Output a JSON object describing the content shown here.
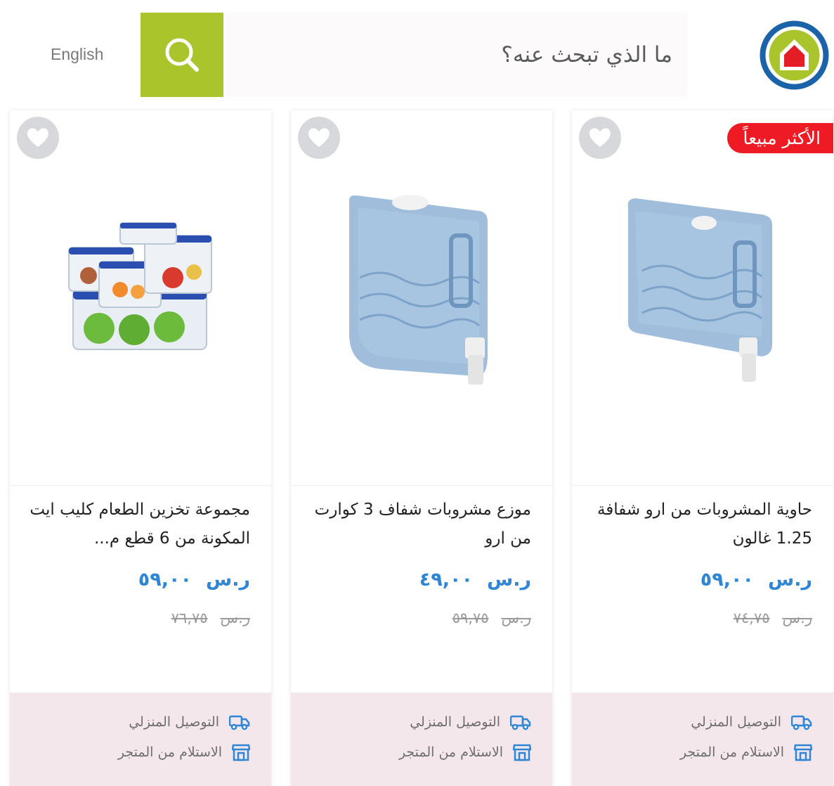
{
  "header": {
    "language_label": "English",
    "search_placeholder": "ما الذي تبحث عنه؟"
  },
  "colors": {
    "accent_green": "#a9c52b",
    "price_blue": "#2f86d6",
    "badge_red": "#ee1b24",
    "logo_blue": "#1a63a8",
    "logo_green": "#a9c52b"
  },
  "products": [
    {
      "badge": "الأكثر مبيعاً",
      "title": "حاوية المشروبات من ارو شفافة 1.25 غالون",
      "price": "٥٩,٠٠",
      "currency": "ر.س",
      "old_price": "٧٤,٧٥",
      "delivery_label": "التوصيل المنزلي",
      "pickup_label": "الاستلام من المتجر"
    },
    {
      "badge": "",
      "title": "موزع مشروبات شفاف 3 كوارت من ارو",
      "price": "٤٩,٠٠",
      "currency": "ر.س",
      "old_price": "٥٩,٧٥",
      "delivery_label": "التوصيل المنزلي",
      "pickup_label": "الاستلام من المتجر"
    },
    {
      "badge": "",
      "title": "مجموعة تخزين الطعام كليب ايت المكونة من 6 قطع م...",
      "price": "٥٩,٠٠",
      "currency": "ر.س",
      "old_price": "٧٦,٧٥",
      "delivery_label": "التوصيل المنزلي",
      "pickup_label": "الاستلام من المتجر"
    }
  ]
}
